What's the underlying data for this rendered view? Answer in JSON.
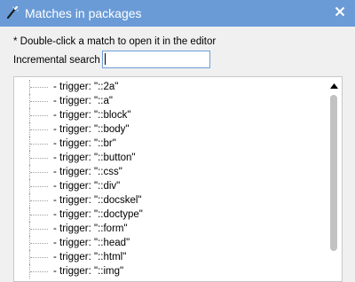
{
  "window": {
    "title": "Matches in packages",
    "title_icon": "wand-icon",
    "close_icon": "close-icon"
  },
  "hint": "* Double-click a match to open it in the editor",
  "search": {
    "label": "Incremental search",
    "value": ""
  },
  "matches": [
    "- trigger: \"::2a\"",
    "- trigger: \"::a\"",
    "- trigger: \"::block\"",
    "- trigger: \"::body\"",
    "- trigger: \"::br\"",
    "- trigger: \"::button\"",
    "- trigger: \"::css\"",
    "- trigger: \"::div\"",
    "- trigger: \"::docskel\"",
    "- trigger: \"::doctype\"",
    "- trigger: \"::form\"",
    "- trigger: \"::head\"",
    "- trigger: \"::html\"",
    "- trigger: \"::img\""
  ],
  "colors": {
    "titlebar": "#6a9bd6",
    "accent": "#6d9fd9"
  }
}
